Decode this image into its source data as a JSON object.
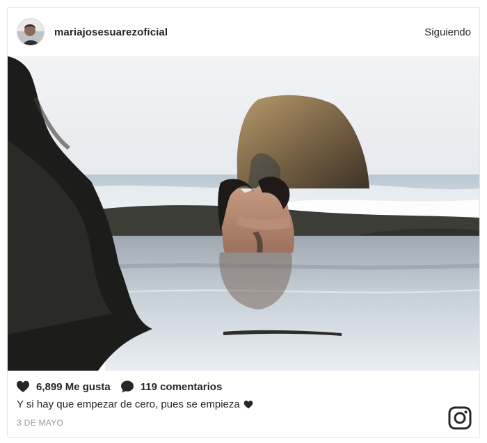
{
  "post": {
    "username": "mariajosesuarezoficial",
    "follow_label": "Siguiendo",
    "likes_label": "6,899 Me gusta",
    "comments_label": "119 comentarios",
    "caption": "Y si hay que empezar de cero, pues se empieza",
    "date": "3 DE MAYO"
  },
  "icons": {
    "like": "heart-icon",
    "comment": "comment-icon",
    "caption_emoji": "black-heart-icon",
    "brand": "instagram-icon"
  },
  "colors": {
    "text": "#262626",
    "muted": "#999999",
    "border": "#e6e6e6"
  }
}
